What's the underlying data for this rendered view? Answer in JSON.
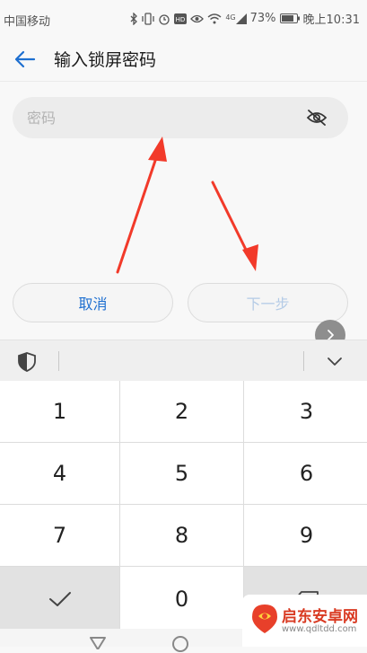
{
  "status_bar": {
    "carrier": "中国移动",
    "network": "4G",
    "battery": "73%",
    "time": "晚上10:31",
    "icons": [
      "bluetooth-icon",
      "vibrate-icon",
      "alarm-icon",
      "hd-icon",
      "eye-comfort-icon",
      "wifi-icon",
      "signal-icon",
      "battery-icon"
    ]
  },
  "header": {
    "title": "输入锁屏密码",
    "back_icon": "back-arrow-icon"
  },
  "password": {
    "placeholder": "密码",
    "value": "",
    "visibility_icon": "eye-hidden-icon"
  },
  "buttons": {
    "cancel": "取消",
    "next": "下一步"
  },
  "keyboard": {
    "toolbar_icons": [
      "shield-icon",
      "chevron-down-icon"
    ],
    "keys": [
      "1",
      "2",
      "3",
      "4",
      "5",
      "6",
      "7",
      "8",
      "9",
      "✓",
      "0",
      "⌫"
    ]
  },
  "watermark": {
    "name": "启东安卓网",
    "url": "www.qdltdd.com"
  },
  "colors": {
    "accent": "#1e6fd0",
    "disabled_accent": "#b4cbe6",
    "annotation_arrow": "#f23a2a"
  }
}
